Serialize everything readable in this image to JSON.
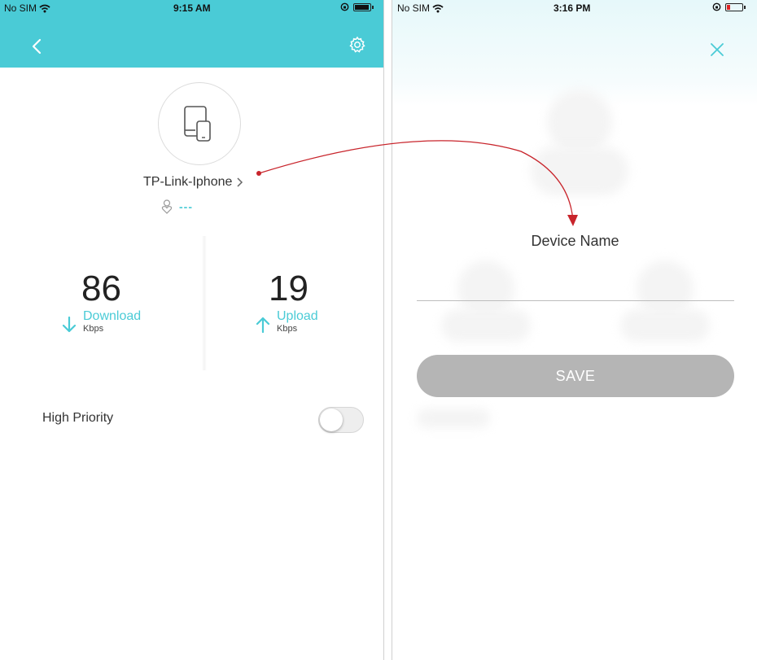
{
  "left_screen": {
    "status": {
      "carrier": "No SIM",
      "time": "9:15 AM"
    },
    "header": {
      "back_icon": "chevron-left-icon",
      "settings_icon": "gear-icon"
    },
    "device": {
      "icon": "tablet-phone-icon",
      "name": "TP-Link-Iphone",
      "owner": "---"
    },
    "download": {
      "value": "86",
      "label": "Download",
      "unit": "Kbps"
    },
    "upload": {
      "value": "19",
      "label": "Upload",
      "unit": "Kbps"
    },
    "priority": {
      "label": "High Priority",
      "enabled": false
    }
  },
  "right_screen": {
    "status": {
      "carrier": "No SIM",
      "time": "3:16 PM"
    },
    "close_icon": "close-icon",
    "title": "Device Name",
    "input_value": "",
    "save_label": "SAVE"
  },
  "colors": {
    "accent": "#4acbd6",
    "annotation_arrow": "#c8242b",
    "save_button": "#b5b5b5"
  }
}
